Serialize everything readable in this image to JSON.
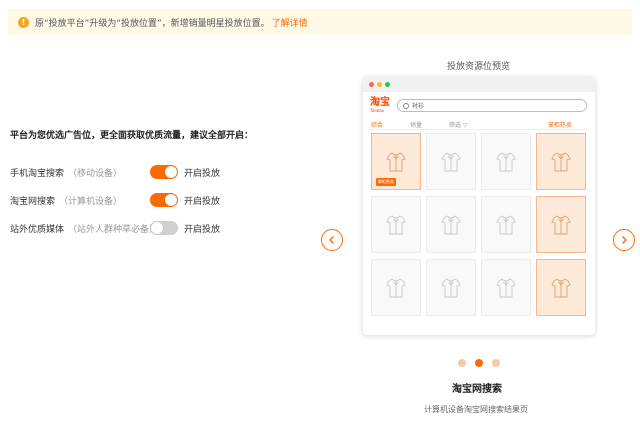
{
  "notice": {
    "icon": "info-icon",
    "text": "原“投放平台”升级为“投放位置”，新增销量明星投放位置。",
    "link": "了解详情"
  },
  "left": {
    "title": "平台为您优选广告位，更全面获取优质流量，建议全部开启：",
    "options": [
      {
        "name": "手机淘宝搜索",
        "sub": "（移动设备）",
        "enabled": true,
        "toggle_label": "开启投放"
      },
      {
        "name": "淘宝网搜索",
        "sub": "（计算机设备）",
        "enabled": true,
        "toggle_label": "开启投放"
      },
      {
        "name": "站外优质媒体",
        "sub": "（站外人群种草必备）",
        "enabled": false,
        "toggle_label": "开启投放"
      }
    ]
  },
  "preview": {
    "title": "投放资源位预览",
    "logo": "淘宝",
    "logo_sub": "Taobao",
    "search_text": "衬衫",
    "tabs": [
      "综合",
      "销量",
      "筛选 ▽",
      "掌柜热卖"
    ],
    "badge": "掌柜热卖",
    "slide_title": "淘宝网搜索",
    "slide_desc": "计算机设备淘宝网搜索结果页",
    "pager_active_index": 1,
    "pager_count": 3
  },
  "colors": {
    "accent": "#ff6a00",
    "notice_bg": "#fef8e6",
    "toggle_off": "#d0d0d0",
    "highlight_cell": "#fde9d8"
  }
}
